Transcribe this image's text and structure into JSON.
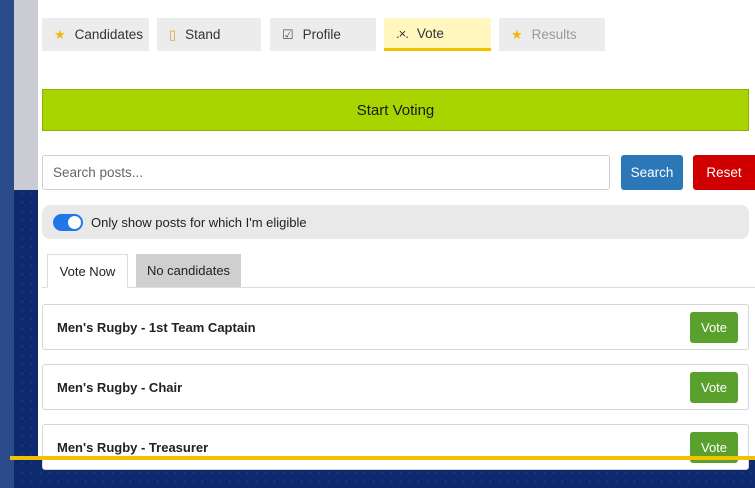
{
  "tabs": [
    {
      "label": "Candidates",
      "icon": "star-icon"
    },
    {
      "label": "Stand",
      "icon": "clipboard-icon"
    },
    {
      "label": "Profile",
      "icon": "checkbox-icon"
    },
    {
      "label": "Vote",
      "icon": "ballot-icon"
    },
    {
      "label": "Results",
      "icon": "star-icon"
    }
  ],
  "start_voting_label": "Start Voting",
  "search": {
    "placeholder": "Search posts...",
    "value": "",
    "search_label": "Search",
    "reset_label": "Reset"
  },
  "filter": {
    "label": "Only show posts for which I'm eligible",
    "enabled": true
  },
  "subtabs": [
    {
      "label": "Vote Now"
    },
    {
      "label": "No candidates"
    }
  ],
  "posts": [
    {
      "title": "Men's Rugby - 1st Team Captain",
      "action": "Vote"
    },
    {
      "title": "Men's Rugby - Chair",
      "action": "Vote"
    },
    {
      "title": "Men's Rugby - Treasurer",
      "action": "Vote"
    }
  ],
  "colors": {
    "accent": "#f2c200",
    "start": "#a8d400",
    "search": "#2c77b8",
    "reset": "#d00000",
    "vote": "#5aa02c",
    "toggle": "#1f78e6"
  }
}
